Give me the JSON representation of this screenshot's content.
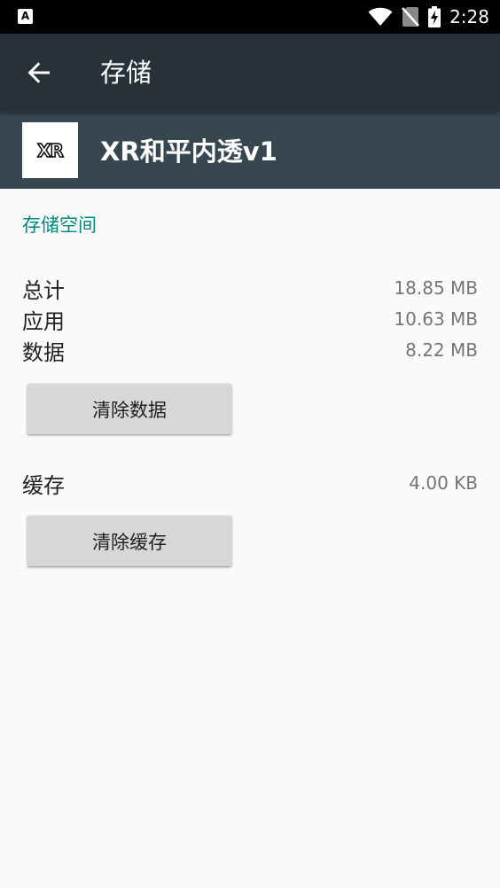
{
  "status_bar": {
    "left_icon": "accessibility-a-icon",
    "left_icon_glyph": "A",
    "icons": [
      "wifi-icon",
      "no-sim-icon",
      "battery-charging-icon"
    ],
    "time": "2:28"
  },
  "app_bar": {
    "back_icon": "arrow-back-icon",
    "title": "存储"
  },
  "app_header": {
    "icon_text": "XR",
    "name": "XR和平内透v1"
  },
  "storage": {
    "section_title": "存储空间",
    "rows": [
      {
        "label": "总计",
        "value": "18.85 MB"
      },
      {
        "label": "应用",
        "value": "10.63 MB"
      },
      {
        "label": "数据",
        "value": "8.22 MB"
      }
    ],
    "clear_data_label": "清除数据"
  },
  "cache": {
    "label": "缓存",
    "value": "4.00 KB",
    "clear_cache_label": "清除缓存"
  },
  "colors": {
    "status_bar": "#000000",
    "app_bar": "#263238",
    "app_header": "#37474f",
    "accent": "#00897b",
    "background": "#fafafa",
    "button": "#d6d7d7"
  }
}
